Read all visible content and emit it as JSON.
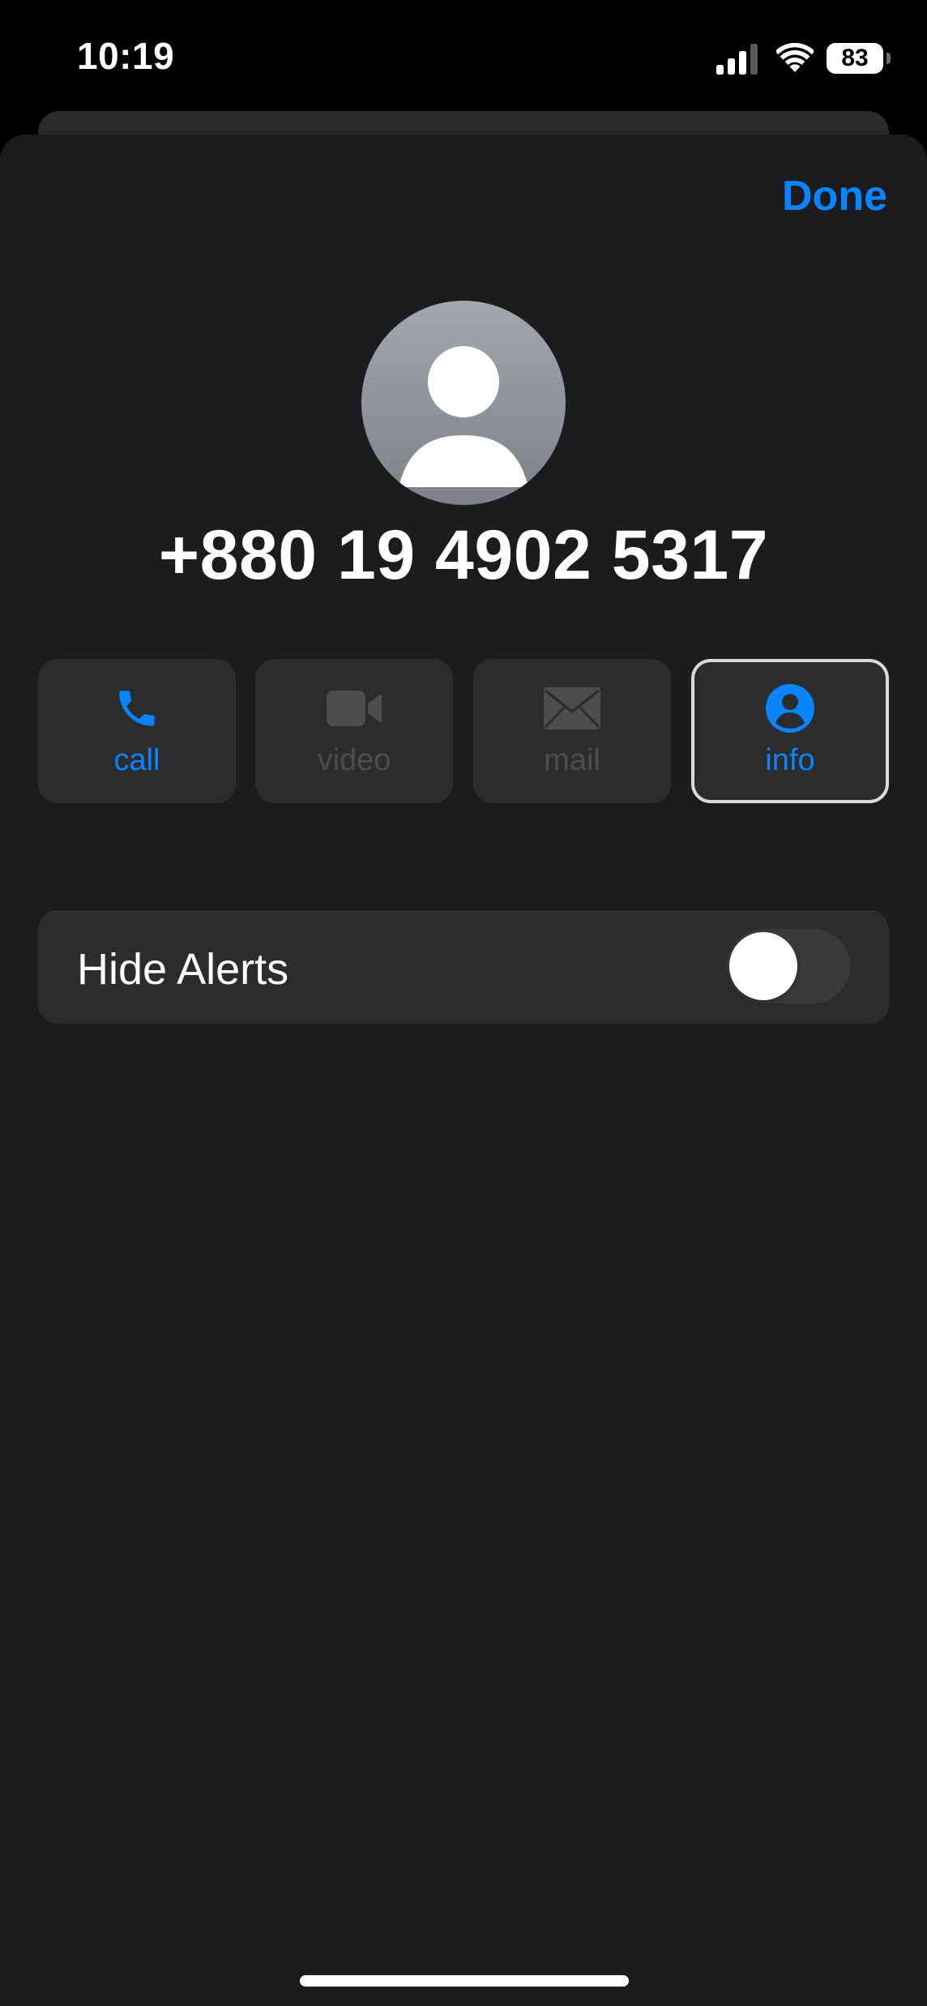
{
  "status_bar": {
    "time": "10:19",
    "battery_level": "83",
    "icons": [
      "signal-icon",
      "wifi-icon",
      "battery-icon"
    ]
  },
  "header": {
    "done_label": "Done"
  },
  "contact": {
    "avatar_icon": "person-silhouette-icon",
    "number": "+880 19 4902 5317"
  },
  "actions": [
    {
      "label": "call",
      "icon": "phone-icon",
      "enabled": true
    },
    {
      "label": "video",
      "icon": "video-camera-icon",
      "enabled": false
    },
    {
      "label": "mail",
      "icon": "envelope-icon",
      "enabled": false
    },
    {
      "label": "info",
      "icon": "person-circle-icon",
      "enabled": true,
      "selected": true
    }
  ],
  "settings": {
    "hide_alerts": {
      "label": "Hide Alerts",
      "on": false
    }
  },
  "colors": {
    "accent": "#0a84ff",
    "sheet_background": "#1c1c1e",
    "card_background": "#2c2c2e",
    "disabled": "#4d4d50"
  }
}
